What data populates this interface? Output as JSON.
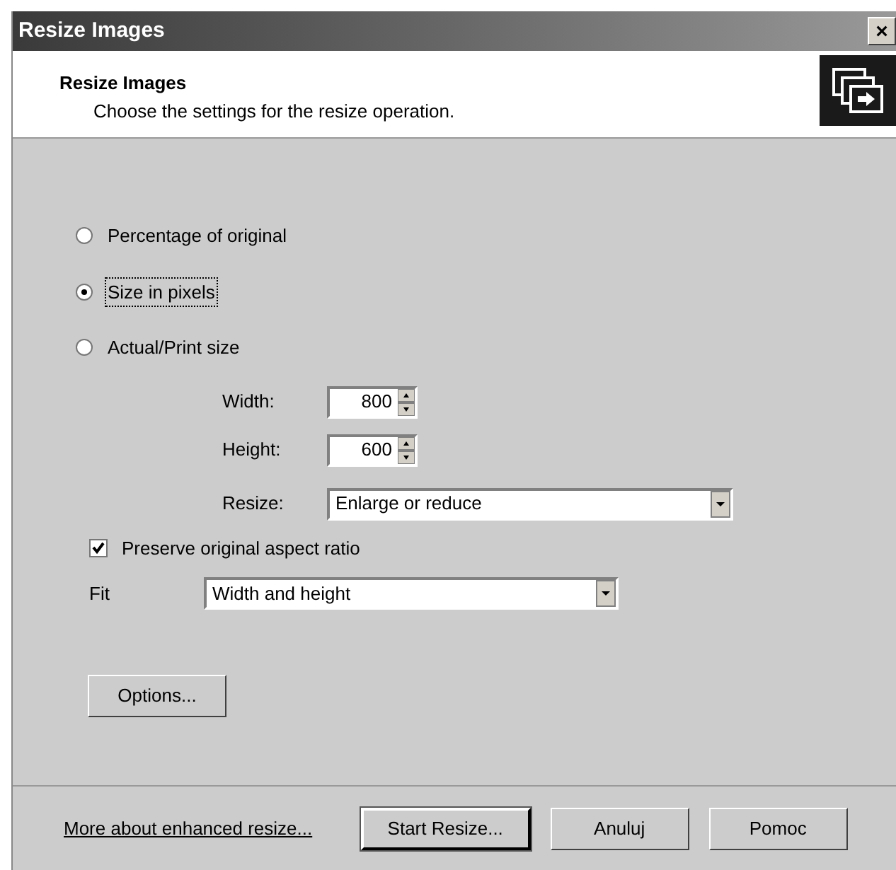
{
  "window": {
    "title": "Resize Images",
    "close": "×"
  },
  "header": {
    "title": "Resize Images",
    "subtitle": "Choose the settings for the resize operation."
  },
  "modes": [
    {
      "label": "Percentage of original",
      "selected": false,
      "focused": false
    },
    {
      "label": "Size in pixels",
      "selected": true,
      "focused": true
    },
    {
      "label": "Actual/Print size",
      "selected": false,
      "focused": false
    }
  ],
  "width": {
    "label": "Width:",
    "value": "800"
  },
  "height": {
    "label": "Height:",
    "value": "600"
  },
  "resize": {
    "label": "Resize:",
    "value": "Enlarge or reduce"
  },
  "preserve": {
    "label": "Preserve original aspect ratio",
    "checked": true
  },
  "fit": {
    "label": "Fit",
    "value": "Width and height"
  },
  "options_button": "Options...",
  "footer": {
    "link": "More about enhanced resize...",
    "buttons": [
      {
        "label": "Start Resize...",
        "default": true
      },
      {
        "label": "Anuluj",
        "default": false
      },
      {
        "label": "Pomoc",
        "default": false
      }
    ]
  }
}
